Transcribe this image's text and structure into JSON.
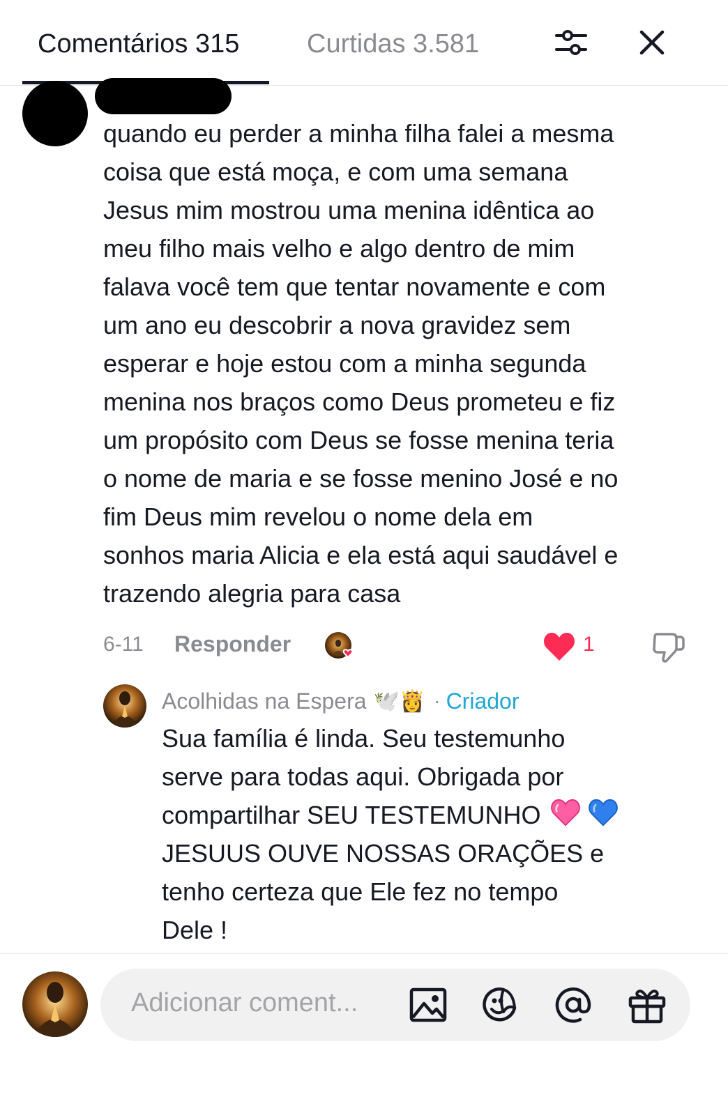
{
  "header": {
    "comments_tab": "Comentários 315",
    "likes_tab": "Curtidas 3.581",
    "filter_icon": "sliders-icon",
    "close_icon": "close-icon"
  },
  "comment": {
    "lines": [
      "quando eu perder a minha filha falei a mesma",
      "coisa que está moça, e com uma semana",
      "Jesus mim mostrou uma menina idêntica ao",
      "meu filho mais velho e algo dentro de mim",
      "falava você tem que tentar novamente e com",
      "um ano eu descobrir a nova gravidez sem",
      "esperar e hoje estou com a minha segunda",
      "menina nos braços como Deus prometeu e fiz",
      "um propósito com Deus se fosse menina teria",
      "o nome de maria e se fosse menino José e no",
      "fim Deus mim revelou o nome dela em",
      "sonhos maria Alicia e ela está aqui saudável e",
      "trazendo alegria para casa"
    ],
    "date": "6-11",
    "reply_label": "Responder",
    "like_count": "1",
    "like_color": "#fe2c55"
  },
  "reply": {
    "author": "Acolhidas na Espera",
    "author_emojis": "🕊️👸",
    "separator": "·",
    "badge": "Criador",
    "badge_color": "#20a6d5",
    "lines": [
      "Sua família é linda. Seu testemunho",
      "serve para todas aqui. Obrigada por",
      "compartilhar SEU TESTEMUNHO",
      "JESUUS OUVE NOSSAS ORAÇÕES e",
      "tenho certeza que Ele fez no tempo",
      "Dele !"
    ],
    "hearts": [
      "pink-heart-icon",
      "blue-heart-icon"
    ]
  },
  "composer": {
    "placeholder": "Adicionar coment...",
    "icons": [
      "image-icon",
      "emoji-icon",
      "mention-icon",
      "gift-icon"
    ]
  }
}
